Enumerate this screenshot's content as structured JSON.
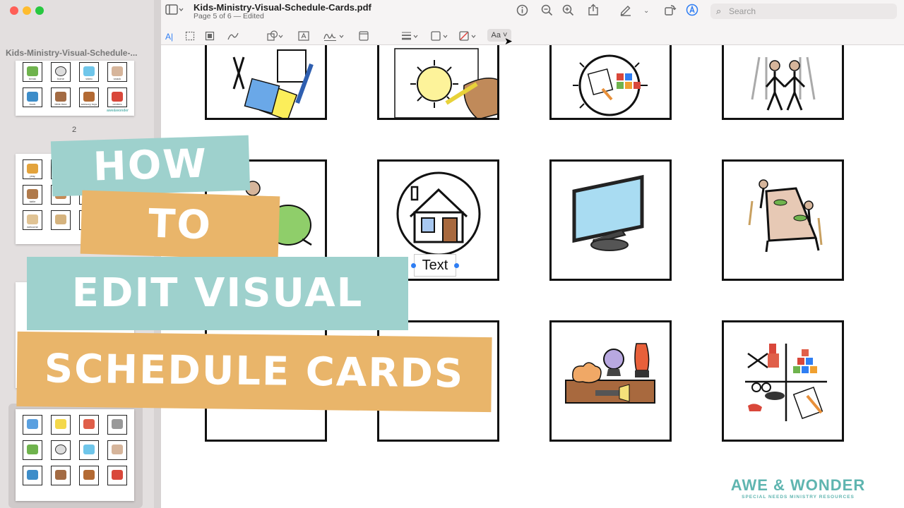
{
  "sidebar": {
    "window_title": "Kids-Ministry-Visual-Schedule-...",
    "page_label_2": "2",
    "thumb_logo": "awe&wonder",
    "thumb1_captions": [
      "break",
      "home",
      "video",
      "snack",
      "book",
      "bible time",
      "sensory toys",
      "centers"
    ],
    "thumb2_captions": [
      "play",
      "",
      "",
      "",
      "table",
      "",
      "",
      "",
      "welcome",
      "",
      "",
      ""
    ]
  },
  "toolbar": {
    "doc_title": "Kids-Ministry-Visual-Schedule-Cards.pdf",
    "doc_subtitle": "Page 5 of 6 — Edited",
    "search_placeholder": "Search",
    "font_button": "Aa"
  },
  "document": {
    "text_annotation": "Text"
  },
  "title_overlay": {
    "line1": "HOW",
    "line2": "TO",
    "line3": "EDIT VISUAL",
    "line4": "SCHEDULE CARDS"
  },
  "brand": {
    "name": "AWE & WONDER",
    "tagline": "SPECIAL NEEDS MINISTRY RESOURCES"
  },
  "colors": {
    "teal_band": "#9ed1cd",
    "orange_band": "#e9b56a",
    "brand_teal": "#5fb5b0",
    "selection_blue": "#2f7ef3"
  }
}
